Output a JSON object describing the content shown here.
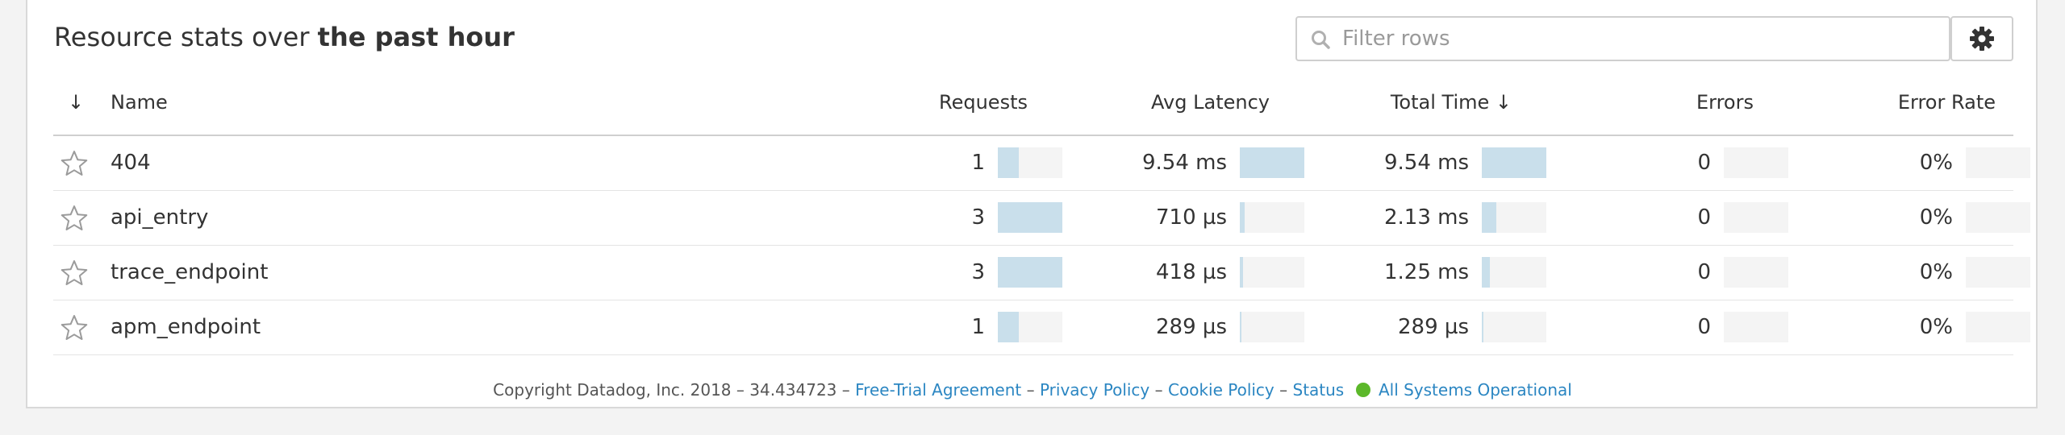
{
  "header": {
    "title_prefix": "Resource stats over",
    "title_emphasis": "the past hour"
  },
  "search": {
    "placeholder": "Filter rows",
    "value": ""
  },
  "settings": {
    "icon": "gear-icon"
  },
  "table": {
    "sort_column_glyph": "↓",
    "columns": {
      "name": "Name",
      "requests": "Requests",
      "avg_latency": "Avg Latency",
      "total_time": "Total Time ↓",
      "errors": "Errors",
      "error_rate": "Error Rate"
    },
    "rows": [
      {
        "name": "404",
        "requests": "1",
        "requests_fill": 0.33,
        "avg_latency": "9.54 ms",
        "avg_latency_fill": 1.0,
        "total_time": "9.54 ms",
        "total_time_fill": 1.0,
        "errors": "0",
        "errors_fill": 0,
        "error_rate": "0%",
        "error_rate_fill": 0
      },
      {
        "name": "api_entry",
        "requests": "3",
        "requests_fill": 1.0,
        "avg_latency": "710 µs",
        "avg_latency_fill": 0.074,
        "total_time": "2.13 ms",
        "total_time_fill": 0.22,
        "errors": "0",
        "errors_fill": 0,
        "error_rate": "0%",
        "error_rate_fill": 0
      },
      {
        "name": "trace_endpoint",
        "requests": "3",
        "requests_fill": 1.0,
        "avg_latency": "418 µs",
        "avg_latency_fill": 0.044,
        "total_time": "1.25 ms",
        "total_time_fill": 0.13,
        "errors": "0",
        "errors_fill": 0,
        "error_rate": "0%",
        "error_rate_fill": 0
      },
      {
        "name": "apm_endpoint",
        "requests": "1",
        "requests_fill": 0.33,
        "avg_latency": "289 µs",
        "avg_latency_fill": 0.03,
        "total_time": "289 µs",
        "total_time_fill": 0.03,
        "errors": "0",
        "errors_fill": 0,
        "error_rate": "0%",
        "error_rate_fill": 0
      }
    ]
  },
  "footer": {
    "copyright": "Copyright Datadog, Inc. 2018 – 34.434723 –",
    "links": [
      "Free-Trial Agreement",
      "Privacy Policy",
      "Cookie Policy",
      "Status"
    ],
    "separator": "–",
    "status_text": "All Systems Operational",
    "status_color": "#5cb82a"
  },
  "colors": {
    "bar_fill": "#c9dfeb",
    "bar_bg": "#f4f4f4",
    "link": "#2b86c2"
  }
}
